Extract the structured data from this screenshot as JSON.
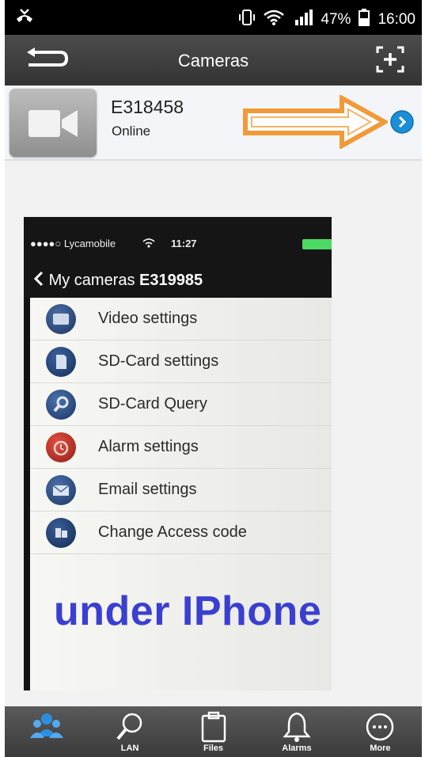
{
  "status_bar": {
    "battery": "47%",
    "time": "16:00"
  },
  "app_bar": {
    "title": "Cameras"
  },
  "camera": {
    "name": "E318458",
    "status": "Online"
  },
  "screenshot": {
    "carrier": "●●●●○ Lycamobile",
    "time": "11:27",
    "nav_back_label": "My cameras",
    "camera_id": "E319985",
    "items": [
      {
        "label": "Video settings",
        "icon": "video-settings-icon",
        "color": "#2c4a7a"
      },
      {
        "label": "SD-Card settings",
        "icon": "sd-card-icon",
        "color": "#1e3f73"
      },
      {
        "label": "SD-Card Query",
        "icon": "magnifier-icon",
        "color": "#264b80"
      },
      {
        "label": "Alarm settings",
        "icon": "alarm-clock-icon",
        "color": "#c03025"
      },
      {
        "label": "Email settings",
        "icon": "envelope-icon",
        "color": "#284b7f"
      },
      {
        "label": "Change Access code",
        "icon": "access-code-icon",
        "color": "#1d3a6c"
      }
    ],
    "overlay_text": "under IPhone"
  },
  "tabs": [
    {
      "label": "",
      "icon": "group-icon",
      "active": true
    },
    {
      "label": "LAN",
      "icon": "search-icon",
      "active": false
    },
    {
      "label": "Files",
      "icon": "clipboard-icon",
      "active": false
    },
    {
      "label": "Alarms",
      "icon": "bell-icon",
      "active": false
    },
    {
      "label": "More",
      "icon": "more-icon",
      "active": false
    }
  ],
  "colors": {
    "accent_arrow": "#f29a3a",
    "go_button": "#1a8fd6",
    "overlay": "#3a3fd2"
  }
}
